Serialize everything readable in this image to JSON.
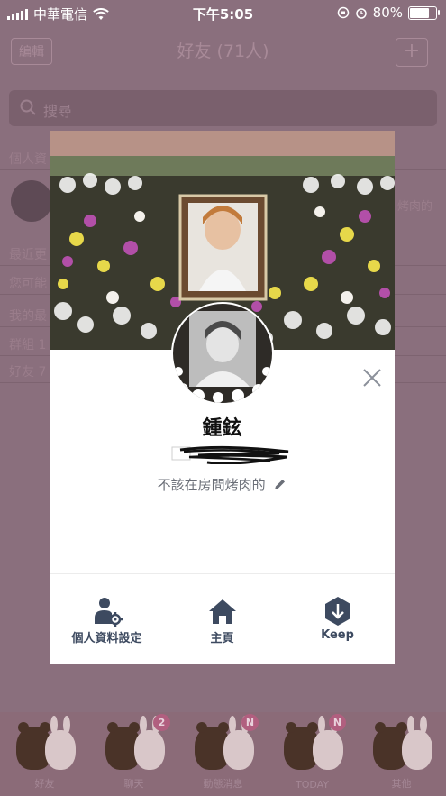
{
  "status_bar": {
    "carrier": "中華電信",
    "time": "下午5:05",
    "battery": "80%",
    "battery_level": 0.8
  },
  "header": {
    "edit_label": "編輯",
    "title": "好友 (71人)",
    "add_label": "+"
  },
  "search": {
    "placeholder": "搜尋"
  },
  "background_list": {
    "profile_section": "個人資",
    "my_status_preview": "烤肉的",
    "sections": [
      "最近更",
      "您可能",
      "我的最",
      "群組 1",
      "好友 7"
    ]
  },
  "profile_card": {
    "name": "鍾鉉",
    "status_message": "不該在房間烤肉的",
    "actions": [
      {
        "label": "個人資料設定",
        "icon": "person-settings-icon"
      },
      {
        "label": "主頁",
        "icon": "home-icon"
      },
      {
        "label": "Keep",
        "icon": "keep-icon"
      }
    ]
  },
  "tab_bar": {
    "tabs": [
      {
        "label": "好友",
        "badge": ""
      },
      {
        "label": "聊天",
        "badge": "2"
      },
      {
        "label": "動態消息",
        "badge": "N"
      },
      {
        "label": "TODAY",
        "badge": "N"
      },
      {
        "label": "其他",
        "badge": ""
      }
    ]
  },
  "colors": {
    "overlay_bg": "#8a6f7d",
    "card_bg": "#ffffff",
    "action_text": "#3d4a60",
    "badge": "#b15f7f"
  }
}
